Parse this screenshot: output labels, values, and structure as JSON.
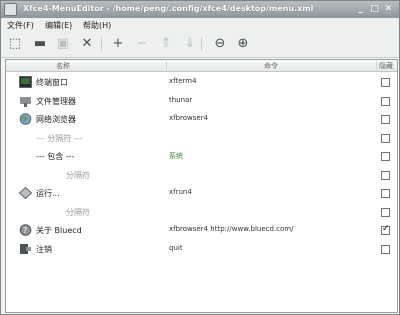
{
  "window": {
    "title": "Xfce4-MenuEditor - /home/peng/.config/xfce4/desktop/menu.xml"
  },
  "menubar": {
    "items": [
      "文件(F)",
      "编辑(E)",
      "帮助(H)"
    ]
  },
  "toolbar": {
    "buttons": [
      {
        "icon": "new-icon",
        "glyph": "⬚",
        "enabled": true
      },
      {
        "icon": "open-icon",
        "glyph": "▬",
        "enabled": true
      },
      {
        "icon": "save-icon",
        "glyph": "▣",
        "enabled": false
      },
      {
        "icon": "close-icon",
        "glyph": "✕",
        "enabled": true
      },
      {
        "icon": "add-icon",
        "glyph": "+",
        "enabled": true
      },
      {
        "icon": "remove-icon",
        "glyph": "−",
        "enabled": false
      },
      {
        "icon": "move-up-icon",
        "glyph": "⇑",
        "enabled": false
      },
      {
        "icon": "move-down-icon",
        "glyph": "⇓",
        "enabled": false
      },
      {
        "icon": "zoom-out-icon",
        "glyph": "⊖",
        "enabled": true
      },
      {
        "icon": "zoom-in-icon",
        "glyph": "⊕",
        "enabled": true
      }
    ]
  },
  "table": {
    "headers": [
      "名称",
      "命令",
      "隐藏"
    ],
    "rows": [
      {
        "icon": "terminal-icon",
        "name": "终端窗口",
        "command": "xfterm4",
        "hidden": false,
        "indent": 0,
        "type": "item"
      },
      {
        "icon": "file-manager-icon",
        "name": "文件管理器",
        "command": "thunar",
        "hidden": false,
        "indent": 0,
        "type": "item"
      },
      {
        "icon": "browser-icon",
        "name": "网络浏览器",
        "command": "xfbrowser4",
        "hidden": false,
        "indent": 0,
        "type": "item"
      },
      {
        "icon": "",
        "name": "--- 分隔符 ---",
        "command": "",
        "hidden": false,
        "indent": 1,
        "type": "separator"
      },
      {
        "icon": "",
        "name": "--- 包含 ---",
        "command": "系统",
        "hidden": false,
        "indent": 1,
        "type": "include"
      },
      {
        "icon": "",
        "name": "分隔符",
        "command": "",
        "hidden": false,
        "indent": 2,
        "type": "separator"
      },
      {
        "icon": "run-icon",
        "name": "运行...",
        "command": "xfrun4",
        "hidden": false,
        "indent": 0,
        "type": "item"
      },
      {
        "icon": "",
        "name": "分隔符",
        "command": "",
        "hidden": false,
        "indent": 2,
        "type": "separator"
      },
      {
        "icon": "help-icon",
        "name": "关于 Bluecd",
        "command": "xfbrowser4 http://www.bluecd.com/",
        "hidden": true,
        "indent": 0,
        "type": "item"
      },
      {
        "icon": "quit-icon",
        "name": "注销",
        "command": "quit",
        "hidden": false,
        "indent": 0,
        "type": "item"
      }
    ]
  }
}
